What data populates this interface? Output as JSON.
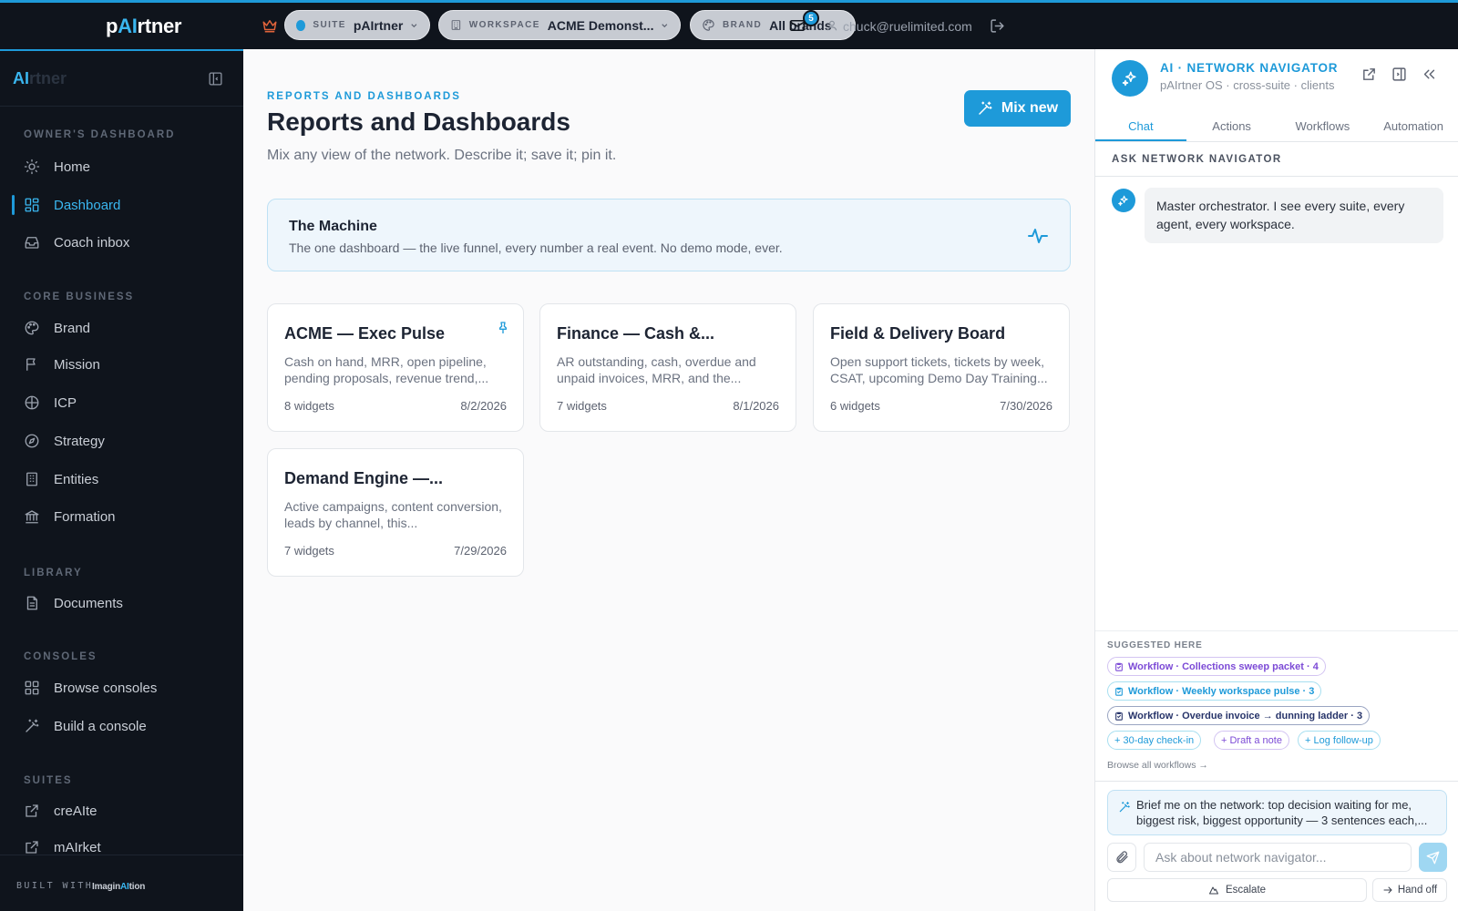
{
  "topbar": {
    "logo_prefix": "p",
    "logo_ai": "AI",
    "logo_suffix": "rtner",
    "suite": {
      "caption": "SUITE",
      "value": "pAIrtner"
    },
    "workspace": {
      "caption": "WORKSPACE",
      "value": "ACME Demonst..."
    },
    "brand": {
      "caption": "BRAND",
      "value": "All brands"
    },
    "notification_count": "5",
    "user_email": "chuck@ruelimited.com",
    "icons": [
      "crown-icon",
      "building-icon",
      "palette-icon",
      "mail-icon",
      "user-icon",
      "logout-icon"
    ]
  },
  "sidebar": {
    "brand_ai": "AI",
    "brand_suffix": "rtner",
    "sections": {
      "owners": "OWNER'S DASHBOARD",
      "core": "CORE BUSINESS",
      "library": "LIBRARY",
      "consoles": "CONSOLES",
      "suites": "SUITES"
    },
    "items": {
      "home": "Home",
      "dashboard": "Dashboard",
      "coach_inbox": "Coach inbox",
      "brand": "Brand",
      "mission": "Mission",
      "icp": "ICP",
      "strategy": "Strategy",
      "entities": "Entities",
      "formation": "Formation",
      "documents": "Documents",
      "browse_consoles": "Browse consoles",
      "build_console": "Build a console",
      "create": "creAIte",
      "market": "mAIrket"
    },
    "footer": {
      "built_with": "BUILT WITH",
      "imag_prefix": "Imagin",
      "imag_ai": "AI",
      "imag_suffix": "tion"
    },
    "accent": "#1e9ad9"
  },
  "main": {
    "eyebrow": "REPORTS AND DASHBOARDS",
    "title": "Reports and Dashboards",
    "subtitle": "Mix any view of the network. Describe it; save it; pin it.",
    "mix_button": "Mix new",
    "machine": {
      "title": "The Machine",
      "desc": "The one dashboard — the live funnel, every number a real event. No demo mode, ever."
    },
    "cards": [
      {
        "title": "ACME — Exec Pulse",
        "desc": "Cash on hand, MRR, open pipeline, pending proposals, revenue trend,...",
        "widgets": "8 widgets",
        "date": "8/2/2026",
        "pinned": true
      },
      {
        "title": "Finance — Cash &...",
        "desc": "AR outstanding, cash, overdue and unpaid invoices, MRR, and the...",
        "widgets": "7 widgets",
        "date": "8/1/2026",
        "pinned": false
      },
      {
        "title": "Field & Delivery Board",
        "desc": "Open support tickets, tickets by week, CSAT, upcoming Demo Day Training...",
        "widgets": "6 widgets",
        "date": "7/30/2026",
        "pinned": false
      },
      {
        "title": "Demand Engine —...",
        "desc": "Active campaigns, content conversion, leads by channel, this...",
        "widgets": "7 widgets",
        "date": "7/29/2026",
        "pinned": false
      }
    ]
  },
  "panel": {
    "title": "AI · NETWORK NAVIGATOR",
    "subtitle": "pAIrtner OS · cross-suite · clients",
    "tabs": [
      "Chat",
      "Actions",
      "Workflows",
      "Automation"
    ],
    "ask_header": "ASK NETWORK NAVIGATOR",
    "message": "Master orchestrator. I see every suite, every agent, every workspace.",
    "suggested_header": "SUGGESTED HERE",
    "chips": {
      "wf1": "Workflow · Collections sweep packet · 4",
      "wf2": "Workflow · Weekly workspace pulse · 3",
      "wf3": "Workflow · Overdue invoice → dunning ladder · 3",
      "q1": "+ 30-day check-in",
      "q2": "+ Draft a note",
      "q3": "+ Log follow-up"
    },
    "browse_link": "Browse all workflows →",
    "prompt": "Brief me on the network: top decision waiting for me, biggest risk, biggest opportunity — 3 sentences each,...",
    "input_placeholder": "Ask about network navigator...",
    "escalate": "Escalate",
    "hand_off": "Hand off"
  }
}
